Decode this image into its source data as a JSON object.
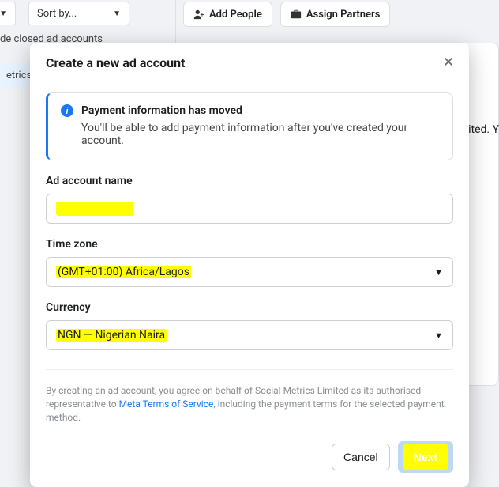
{
  "background": {
    "sortby_label": "Sort by...",
    "add_people_label": "Add People",
    "assign_partners_label": "Assign Partners",
    "closed_accounts_text": "de closed ad accounts",
    "row_label": "etrics Li",
    "right_text": "mited. Y"
  },
  "modal": {
    "title": "Create a new ad account",
    "info_title": "Payment information has moved",
    "info_body": "You'll be able to add payment information after you've created your account.",
    "ad_account_name_label": "Ad account name",
    "time_zone_label": "Time zone",
    "time_zone_value": "(GMT+01:00) Africa/Lagos",
    "currency_label": "Currency",
    "currency_value": "NGN — Nigerian Naira",
    "legal_pre": "By creating an ad account, you agree on behalf of Social Metrics Limited as its authorised representative to ",
    "legal_link": "Meta Terms of Service",
    "legal_post": ", including the payment terms for the selected payment method.",
    "cancel_label": "Cancel",
    "next_label": "Next"
  }
}
